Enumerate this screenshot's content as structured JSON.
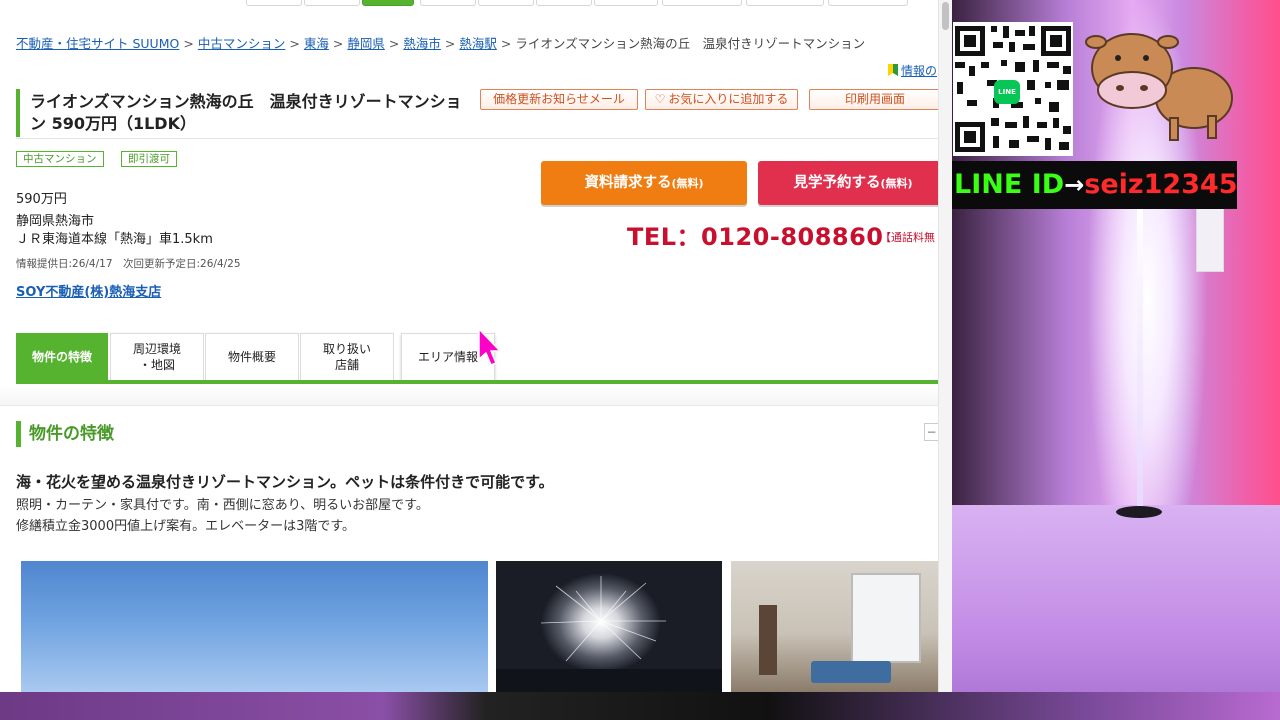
{
  "breadcrumb": {
    "items": [
      "不動産・住宅サイト SUUMO",
      "中古マンション",
      "東海",
      "静岡県",
      "熱海市",
      "熱海駅"
    ],
    "sep": ">",
    "current": "ライオンズマンション熱海の丘　温泉付きリゾートマンション"
  },
  "info_link": "情報の",
  "listing": {
    "title": "ライオンズマンション熱海の丘　温泉付きリゾートマンション 590万円（1LDK）",
    "tags": [
      "中古マンション",
      "即引渡可"
    ],
    "price": "590万円",
    "address": "静岡県熱海市",
    "access": "ＪＲ東海道本線「熱海」車1.5km",
    "info_dates": "情報提供日:26/4/17　次回更新予定日:26/4/25",
    "agent": "SOY不動産(株)熱海支店"
  },
  "actions": {
    "price_alert": "価格更新お知らせメール",
    "favorite": "お気に入りに追加する",
    "print": "印刷用画面",
    "request_main": "資料請求する",
    "request_sub": "(無料)",
    "visit_main": "見学予約する",
    "visit_sub": "(無料)",
    "tel": "TEL：0120-808860",
    "tel_note": "【通話料無"
  },
  "tabs": {
    "features": "物件の特徴",
    "surroundings_1": "周辺環境",
    "surroundings_2": "・地図",
    "outline": "物件概要",
    "shop_1": "取り扱い",
    "shop_2": "店舗",
    "area": "エリア情報"
  },
  "features": {
    "heading": "物件の特徴",
    "collapse": "−",
    "lead": "海・花火を望める温泉付きリゾートマンション。ペットは条件付きで可能です。",
    "line1": "照明・カーテン・家具付です。南・西側に窓あり、明るいお部屋です。",
    "line2": "修繕積立金3000円値上げ案有。エレベーターは3階です。"
  },
  "overlay": {
    "line_label": "LINE ID",
    "arrow": "→",
    "line_id": "seiz12345",
    "line_badge": "LINE"
  },
  "colors": {
    "suumo_green": "#55b330",
    "request_orange": "#ef7d12",
    "visit_red": "#e0304e",
    "tel_red": "#c8102e",
    "link_blue": "#1a5fb4"
  },
  "icons": {
    "favorite": "heart-icon",
    "info": "beginner-mark-icon",
    "cursor": "pointer-cursor-icon"
  }
}
